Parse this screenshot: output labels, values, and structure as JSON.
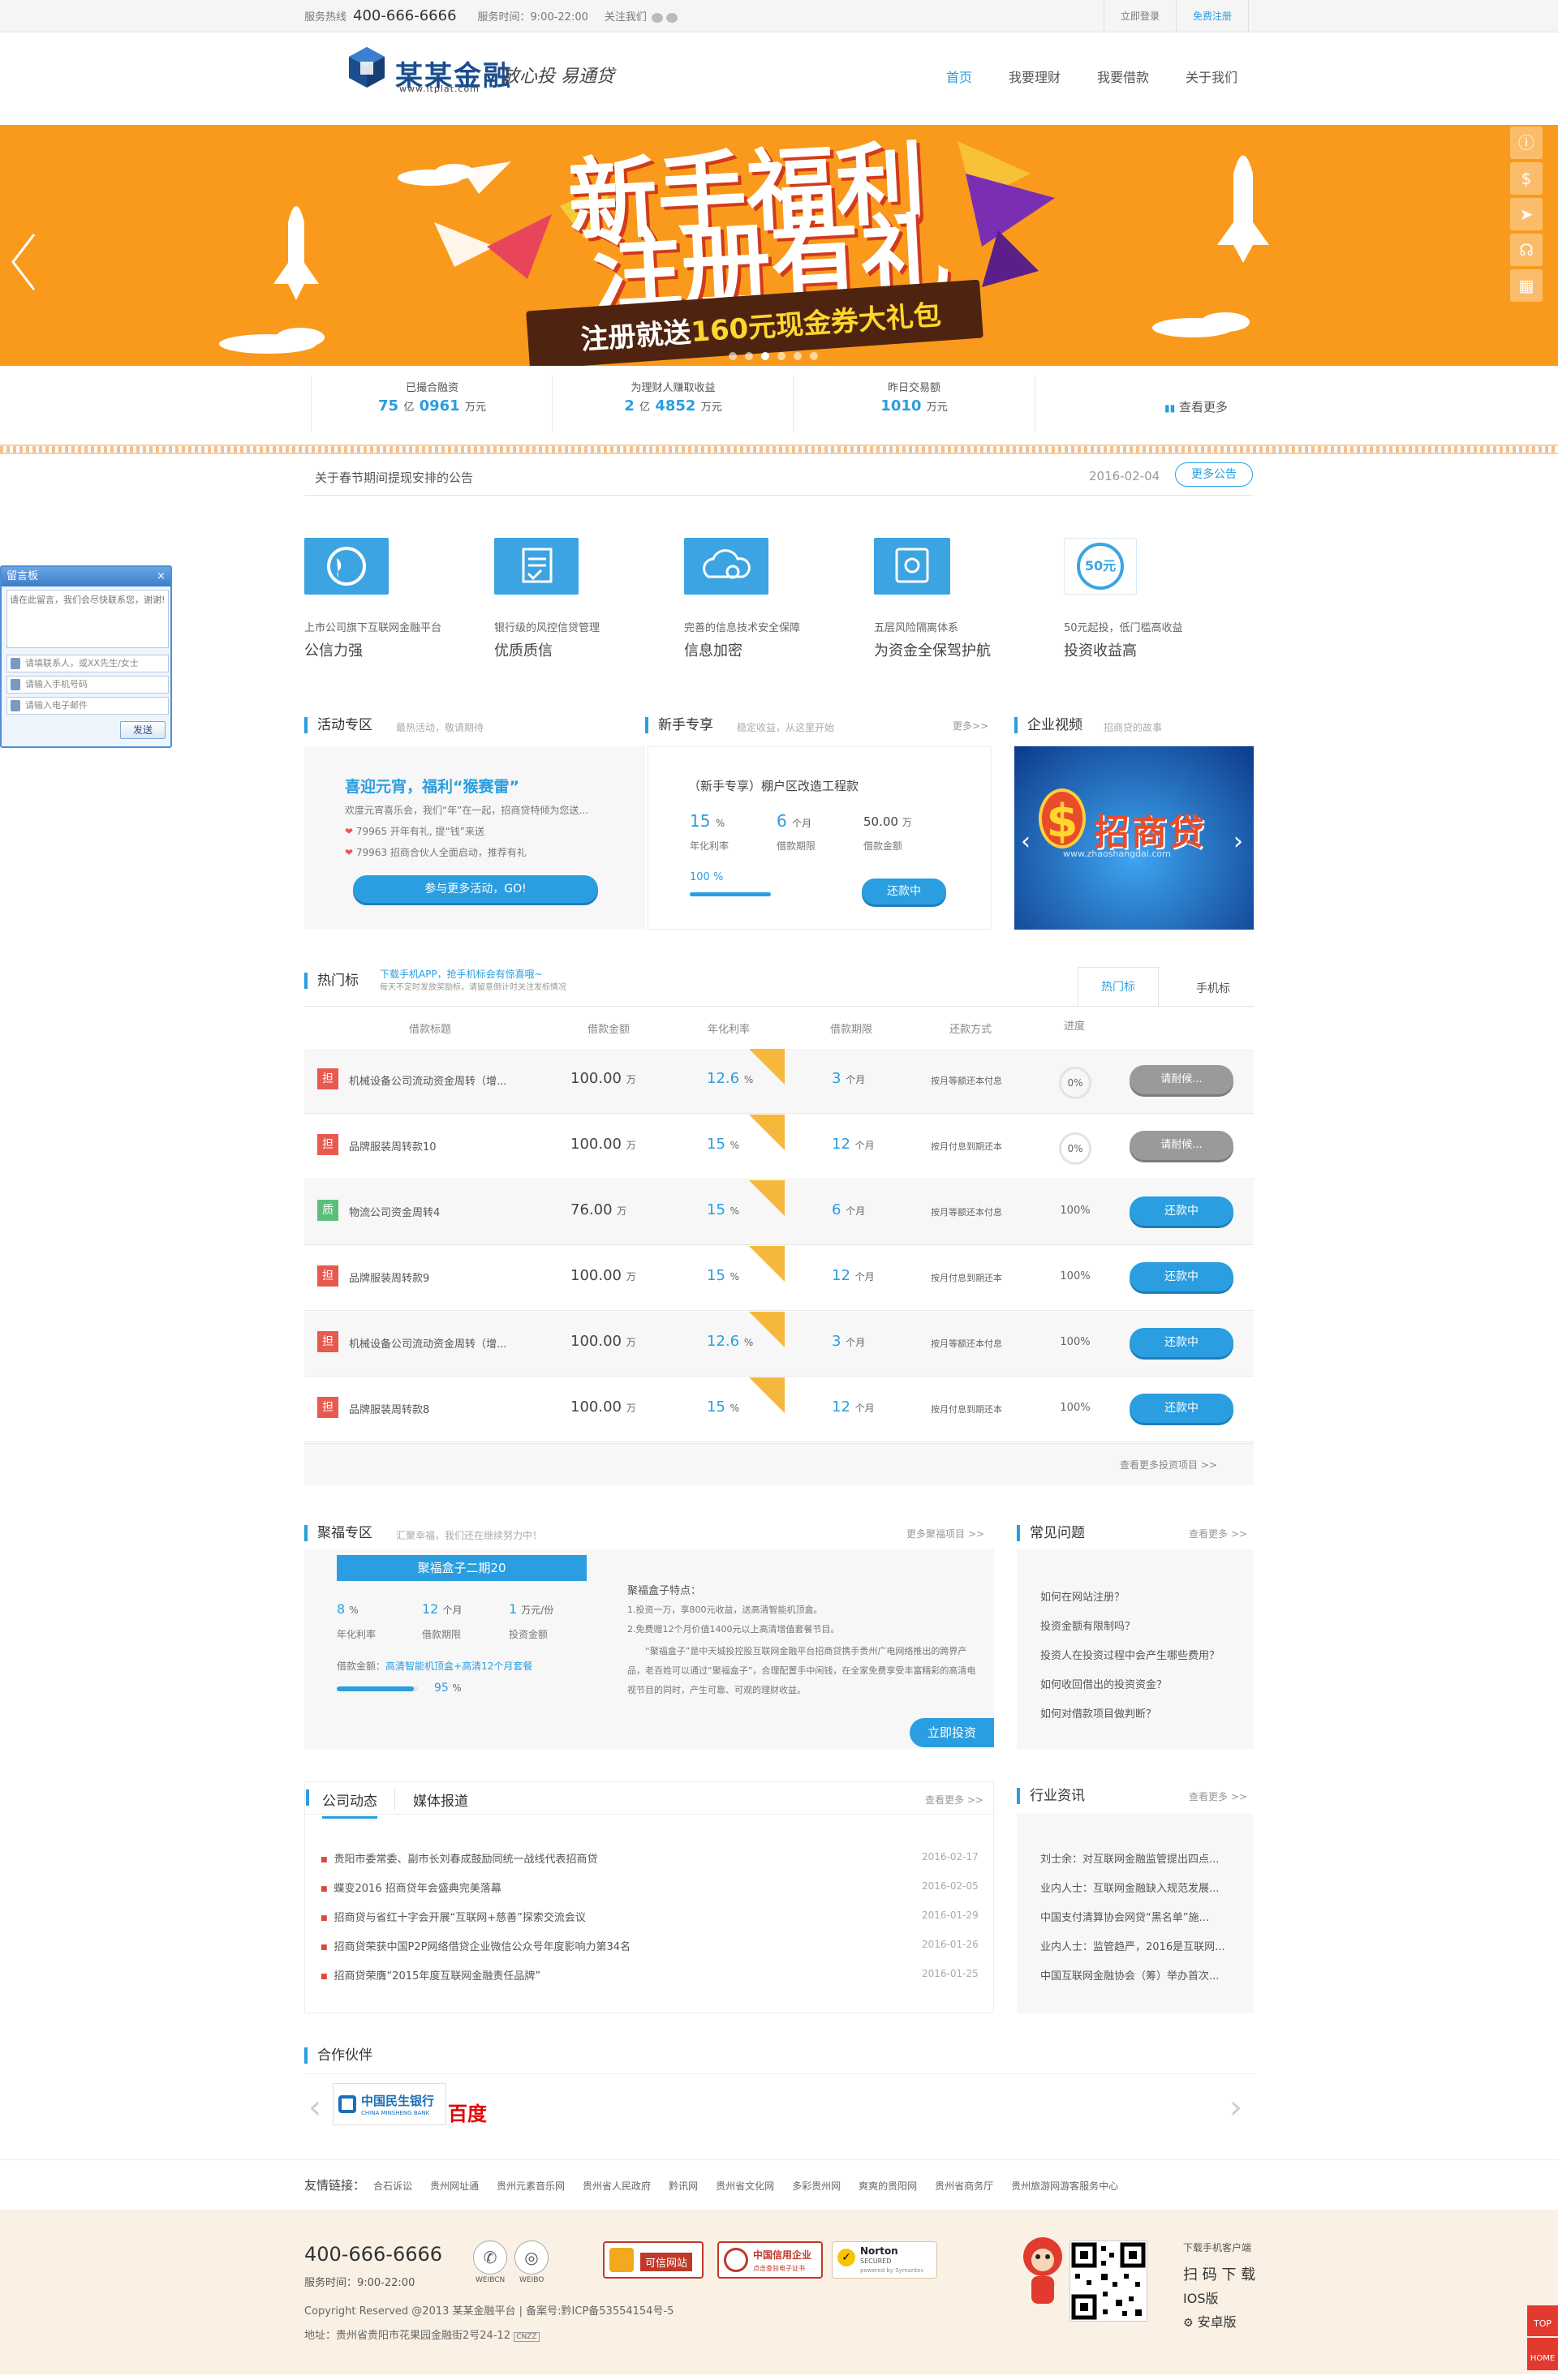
{
  "topbar": {
    "hotline_label": "服务热线",
    "hotline": "400-666-6666",
    "hours": "服务时间：9:00-22:00",
    "follow": "关注我们",
    "login": "立即登录",
    "register": "免费注册"
  },
  "header": {
    "logo_text": "某某金融",
    "logo_url": "www.itplat.com",
    "slogan": "放心投  易通贷",
    "nav": [
      "首页",
      "我要理财",
      "我要借款",
      "关于我们"
    ]
  },
  "banner": {
    "title_line1": "新手福利",
    "title_line2": "注册有礼",
    "sub_prefix": "注册就送",
    "sub_highlight": "160元现金券大礼包"
  },
  "stats": [
    {
      "label": "已撮合融资",
      "v1": "75",
      "u1": "亿",
      "v2": "0961",
      "u2": "万元"
    },
    {
      "label": "为理财人赚取收益",
      "v1": "2",
      "u1": "亿",
      "v2": "4852",
      "u2": "万元"
    },
    {
      "label": "昨日交易额",
      "v1": "1010",
      "u1": "",
      "v2": "",
      "u2": "万元"
    }
  ],
  "stats_more": "查看更多",
  "notice": {
    "text": "关于春节期间提现安排的公告",
    "date": "2016-02-04",
    "more": "更多公告"
  },
  "features": [
    {
      "icon": "globe-icon",
      "desc": "上市公司旗下互联网金融平台",
      "title": "公信力强"
    },
    {
      "icon": "document-check-icon",
      "desc": "银行级的风控信贷管理",
      "title": "优质质信"
    },
    {
      "icon": "cloud-lock-icon",
      "desc": "完善的信息技术安全保障",
      "title": "信息加密"
    },
    {
      "icon": "safe-box-icon",
      "desc": "五层风险隔离体系",
      "title": "为资金全保驾护航"
    },
    {
      "icon": "coin-50-icon",
      "desc": "50元起投，低门槛高收益",
      "title": "投资收益高",
      "coin": "50元"
    }
  ],
  "activity": {
    "title": "活动专区",
    "sub": "最热活动，敬请期待",
    "headline": "喜迎元宵，福利“猴赛雷”",
    "desc": "欢度元宵喜乐会，我们“年”在一起，招商贷特倾为您送...",
    "lines": [
      "79965 开年有礼, 提“钱”来送",
      "79963 招商合伙人全面启动，推荐有礼"
    ],
    "button": "参与更多活动，GO!"
  },
  "novice": {
    "title": "新手专享",
    "sub": "稳定收益，从这里开始",
    "more": "更多>>",
    "project": "（新手专享）棚户区改造工程款",
    "rate": "15",
    "rate_unit": "%",
    "period": "6",
    "period_unit": "个月",
    "amount": "50.00",
    "amount_unit": "万",
    "rate_label": "年化利率",
    "period_label": "借款期限",
    "amount_label": "借款金额",
    "progress": "100 %",
    "progress_value": 1.0,
    "button": "还款中"
  },
  "video": {
    "title": "企业视频",
    "sub": "招商贷的故事",
    "brand": "招商贷",
    "url": "www.zhaoshangdai.com"
  },
  "hot": {
    "title": "热门标",
    "promo": "下载手机APP，抢手机标会有惊喜哦~",
    "promo2": "每天不定时发放奖励标，请留意倒计时关注发标情况",
    "tabs": [
      "热门标",
      "手机标"
    ],
    "headers": [
      "借款标题",
      "借款金额",
      "年化利率",
      "借款期限",
      "还款方式",
      "进度"
    ],
    "rows": [
      {
        "tag": "担",
        "tag_color": "#e8594e",
        "name": "机械设备公司流动资金周转（增...",
        "amount": "100.00",
        "amount_unit": "万",
        "rate": "12.6",
        "rate_unit": "%",
        "period": "3",
        "period_unit": "个月",
        "method": "按月等额还本付息",
        "progress": "0%",
        "progress_style": "ring",
        "button": "请耐候...",
        "button_style": "grey"
      },
      {
        "tag": "担",
        "tag_color": "#e8594e",
        "name": "品牌服装周转款10",
        "amount": "100.00",
        "amount_unit": "万",
        "rate": "15",
        "rate_unit": "%",
        "period": "12",
        "period_unit": "个月",
        "method": "按月付息到期还本",
        "progress": "0%",
        "progress_style": "ring",
        "button": "请耐候...",
        "button_style": "grey"
      },
      {
        "tag": "质",
        "tag_color": "#5bbf7a",
        "name": "物流公司资金周转4",
        "amount": "76.00",
        "amount_unit": "万",
        "rate": "15",
        "rate_unit": "%",
        "period": "6",
        "period_unit": "个月",
        "method": "按月等额还本付息",
        "progress": "100%",
        "progress_style": "text",
        "button": "还款中",
        "button_style": "blue"
      },
      {
        "tag": "担",
        "tag_color": "#e8594e",
        "name": "品牌服装周转款9",
        "amount": "100.00",
        "amount_unit": "万",
        "rate": "15",
        "rate_unit": "%",
        "period": "12",
        "period_unit": "个月",
        "method": "按月付息到期还本",
        "progress": "100%",
        "progress_style": "text",
        "button": "还款中",
        "button_style": "blue"
      },
      {
        "tag": "担",
        "tag_color": "#e8594e",
        "name": "机械设备公司流动资金周转（增...",
        "amount": "100.00",
        "amount_unit": "万",
        "rate": "12.6",
        "rate_unit": "%",
        "period": "3",
        "period_unit": "个月",
        "method": "按月等额还本付息",
        "progress": "100%",
        "progress_style": "text",
        "button": "还款中",
        "button_style": "blue"
      },
      {
        "tag": "担",
        "tag_color": "#e8594e",
        "name": "品牌服装周转款8",
        "amount": "100.00",
        "amount_unit": "万",
        "rate": "15",
        "rate_unit": "%",
        "period": "12",
        "period_unit": "个月",
        "method": "按月付息到期还本",
        "progress": "100%",
        "progress_style": "text",
        "button": "还款中",
        "button_style": "blue"
      }
    ],
    "more": "查看更多投资项目 >>"
  },
  "jufu": {
    "title": "聚福专区",
    "sub": "汇聚幸福，我们还在继续努力中！",
    "more": "更多聚福项目 >>",
    "product": "聚福盒子二期20",
    "rate": "8",
    "rate_unit": "%",
    "period": "12",
    "period_unit": "个月",
    "amount": "1",
    "amount_unit": "万元/份",
    "rate_label": "年化利率",
    "period_label": "借款期限",
    "amount_label": "投资金额",
    "loan_label": "借款金额：",
    "loan_value": "高清智能机顶盒+高清12个月套餐",
    "progress": "95",
    "progress_unit": "%",
    "progress_value": 0.95,
    "features_title": "聚福盒子特点：",
    "features": [
      "1.投资一万，享800元收益，送高清智能机顶盒。",
      "2.免费赠12个月价值1400元以上高清增值套餐节目。",
      "“聚福盒子”是中天城投控股互联网金融平台招商贷携手贵州广电网络推出的跨界产品，老百姓可以通过“聚福盒子”，合理配置手中闲钱，在全家免费享受丰富精彩的高清电视节目的同时，产生可靠、可观的理财收益。"
    ],
    "button": "立即投资"
  },
  "faq": {
    "title": "常见问题",
    "more": "查看更多 >>",
    "items": [
      "如何在网站注册？",
      "投资金额有限制吗？",
      "投资人在投资过程中会产生哪些费用？",
      "如何收回借出的投资资金？",
      "如何对借款项目做判断？"
    ]
  },
  "news": {
    "tabs": [
      "公司动态",
      "媒体报道"
    ],
    "more": "查看更多 >>",
    "items": [
      {
        "title": "贵阳市委常委、副市长刘春成鼓励同统一战线代表招商贷",
        "date": "2016-02-17"
      },
      {
        "title": "蝶变2016 招商贷年会盛典完美落幕",
        "date": "2016-02-05"
      },
      {
        "title": "招商贷与省红十字会开展“互联网+慈善”探索交流会议",
        "date": "2016-01-29"
      },
      {
        "title": "招商贷荣获中国P2P网络借贷企业微信公众号年度影响力第34名",
        "date": "2016-01-26"
      },
      {
        "title": "招商贷荣膺“2015年度互联网金融责任品牌”",
        "date": "2016-01-25"
      }
    ]
  },
  "industry": {
    "title": "行业资讯",
    "more": "查看更多 >>",
    "items": [
      "刘士余：对互联网金融监管提出四点...",
      "业内人士：互联网金融缺入规范发展...",
      "中国支付清算协会网贷“黑名单”施...",
      "业内人士：监管趋严，2016是互联网...",
      "中国互联网金融协会（筹）举办首次..."
    ]
  },
  "partners": {
    "title": "合作伙伴",
    "items": [
      {
        "name": "中国民生银行",
        "en": "CHINA MINSHENG BANK"
      },
      {
        "name": "百度"
      }
    ]
  },
  "links": {
    "label": "友情链接：",
    "items": [
      "合石诉讼",
      "贵州网址通",
      "贵州元素音乐网",
      "贵州省人民政府",
      "黔讯网",
      "贵州省文化网",
      "多彩贵州网",
      "爽爽的贵阳网",
      "贵州省商务厅",
      "贵州旅游网游客服务中心"
    ]
  },
  "footer": {
    "phone": "400-666-6666",
    "hours": "服务时间：9:00-22:00",
    "copyright": "Copyright Reserved @2013 某某金融平台 | 备案号:黔ICP备53554154号-5",
    "address": "地址：贵州省贵阳市花果园金融街2号24-12",
    "cnzz": "CNZZ",
    "social": [
      {
        "name": "WEIBCN"
      },
      {
        "name": "WEIBO"
      }
    ],
    "badges": [
      {
        "text": "可信网站"
      },
      {
        "text": "中国信用企业",
        "sub": "点击查验电子证书"
      },
      {
        "text": "Norton",
        "sub": "SECURED",
        "sub2": "powered by Symantec"
      }
    ],
    "app": {
      "title": "下载手机客户端",
      "big": "扫 码 下 载",
      "ios": "IOS版",
      "android": "安卓版"
    },
    "top": "TOP",
    "home": "HOME"
  },
  "chat": {
    "title": "留言板",
    "close": "×",
    "placeholder": "请在此留言，我们会尽快联系您，谢谢!",
    "contact": "请填联系人，或XX先生/女士",
    "phone": "请输入手机号码",
    "email": "请输入电子邮件",
    "send": "发送"
  },
  "colors": {
    "accent": "#2a9ee0",
    "banner": "#fa9a1c",
    "red_tag": "#e8594e",
    "green_tag": "#5bbf7a",
    "ribbon": "#f6b83c"
  }
}
